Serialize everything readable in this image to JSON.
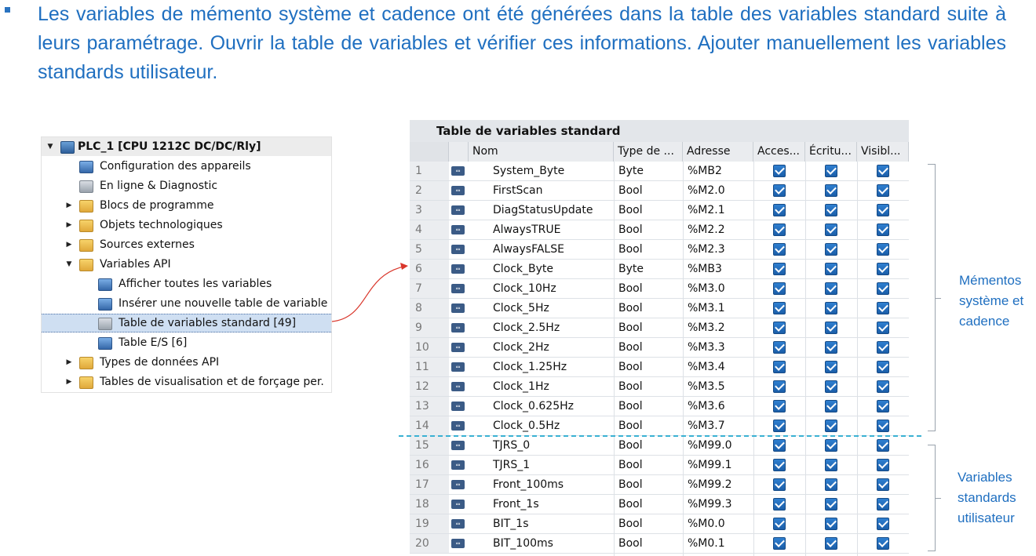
{
  "intro_text": "Les variables de mémento système et cadence ont été générées dans la table des variables standard suite à leurs paramétrage. Ouvrir la table de variables et vérifier ces informations. Ajouter manuellement les variables standards utilisateur.",
  "tree": {
    "root": "PLC_1 [CPU 1212C DC/DC/Rly]",
    "items": [
      {
        "label": "Configuration des appareils",
        "icon": "device-config-icon"
      },
      {
        "label": "En ligne & Diagnostic",
        "icon": "online-diagnostic-icon"
      },
      {
        "label": "Blocs de programme",
        "icon": "folder-icon"
      },
      {
        "label": "Objets technologiques",
        "icon": "folder-icon"
      },
      {
        "label": "Sources externes",
        "icon": "folder-icon"
      },
      {
        "label": "Variables API",
        "icon": "folder-icon"
      },
      {
        "label": "Afficher toutes les variables",
        "icon": "tag-table-icon"
      },
      {
        "label": "Insérer une nouvelle table de variable",
        "icon": "new-table-icon"
      },
      {
        "label": "Table de variables standard [49]",
        "icon": "tag-table-icon"
      },
      {
        "label": "Table E/S [6]",
        "icon": "tag-table-icon"
      },
      {
        "label": "Types de données API",
        "icon": "folder-icon"
      },
      {
        "label": "Tables de visualisation et de forçage per.",
        "icon": "folder-icon"
      }
    ]
  },
  "table": {
    "title": "Table de variables standard",
    "headers": [
      "Nom",
      "Type de ...",
      "Adresse",
      "Acces...",
      "Écritu...",
      "Visibl..."
    ],
    "rows": [
      {
        "n": "1",
        "name": "System_Byte",
        "type": "Byte",
        "addr": "%MB2"
      },
      {
        "n": "2",
        "name": "FirstScan",
        "type": "Bool",
        "addr": "%M2.0"
      },
      {
        "n": "3",
        "name": "DiagStatusUpdate",
        "type": "Bool",
        "addr": "%M2.1"
      },
      {
        "n": "4",
        "name": "AlwaysTRUE",
        "type": "Bool",
        "addr": "%M2.2"
      },
      {
        "n": "5",
        "name": "AlwaysFALSE",
        "type": "Bool",
        "addr": "%M2.3"
      },
      {
        "n": "6",
        "name": "Clock_Byte",
        "type": "Byte",
        "addr": "%MB3"
      },
      {
        "n": "7",
        "name": "Clock_10Hz",
        "type": "Bool",
        "addr": "%M3.0"
      },
      {
        "n": "8",
        "name": "Clock_5Hz",
        "type": "Bool",
        "addr": "%M3.1"
      },
      {
        "n": "9",
        "name": "Clock_2.5Hz",
        "type": "Bool",
        "addr": "%M3.2"
      },
      {
        "n": "10",
        "name": "Clock_2Hz",
        "type": "Bool",
        "addr": "%M3.3"
      },
      {
        "n": "11",
        "name": "Clock_1.25Hz",
        "type": "Bool",
        "addr": "%M3.4"
      },
      {
        "n": "12",
        "name": "Clock_1Hz",
        "type": "Bool",
        "addr": "%M3.5"
      },
      {
        "n": "13",
        "name": "Clock_0.625Hz",
        "type": "Bool",
        "addr": "%M3.6"
      },
      {
        "n": "14",
        "name": "Clock_0.5Hz",
        "type": "Bool",
        "addr": "%M3.7"
      },
      {
        "n": "15",
        "name": "TJRS_0",
        "type": "Bool",
        "addr": "%M99.0"
      },
      {
        "n": "16",
        "name": "TJRS_1",
        "type": "Bool",
        "addr": "%M99.1"
      },
      {
        "n": "17",
        "name": "Front_100ms",
        "type": "Bool",
        "addr": "%M99.2"
      },
      {
        "n": "18",
        "name": "Front_1s",
        "type": "Bool",
        "addr": "%M99.3"
      },
      {
        "n": "19",
        "name": "BIT_1s",
        "type": "Bool",
        "addr": "%M0.0"
      },
      {
        "n": "20",
        "name": "BIT_100ms",
        "type": "Bool",
        "addr": "%M0.1"
      }
    ],
    "checkbox_state": true
  },
  "annotations": {
    "system": "Mémentos système et cadence",
    "user": "Variables standards utilisateur"
  },
  "colors": {
    "accent_text": "#1f6fc0",
    "checkbox": "#1b5ea9",
    "divider": "#3ab1d3",
    "selection": "#cfdff2"
  }
}
